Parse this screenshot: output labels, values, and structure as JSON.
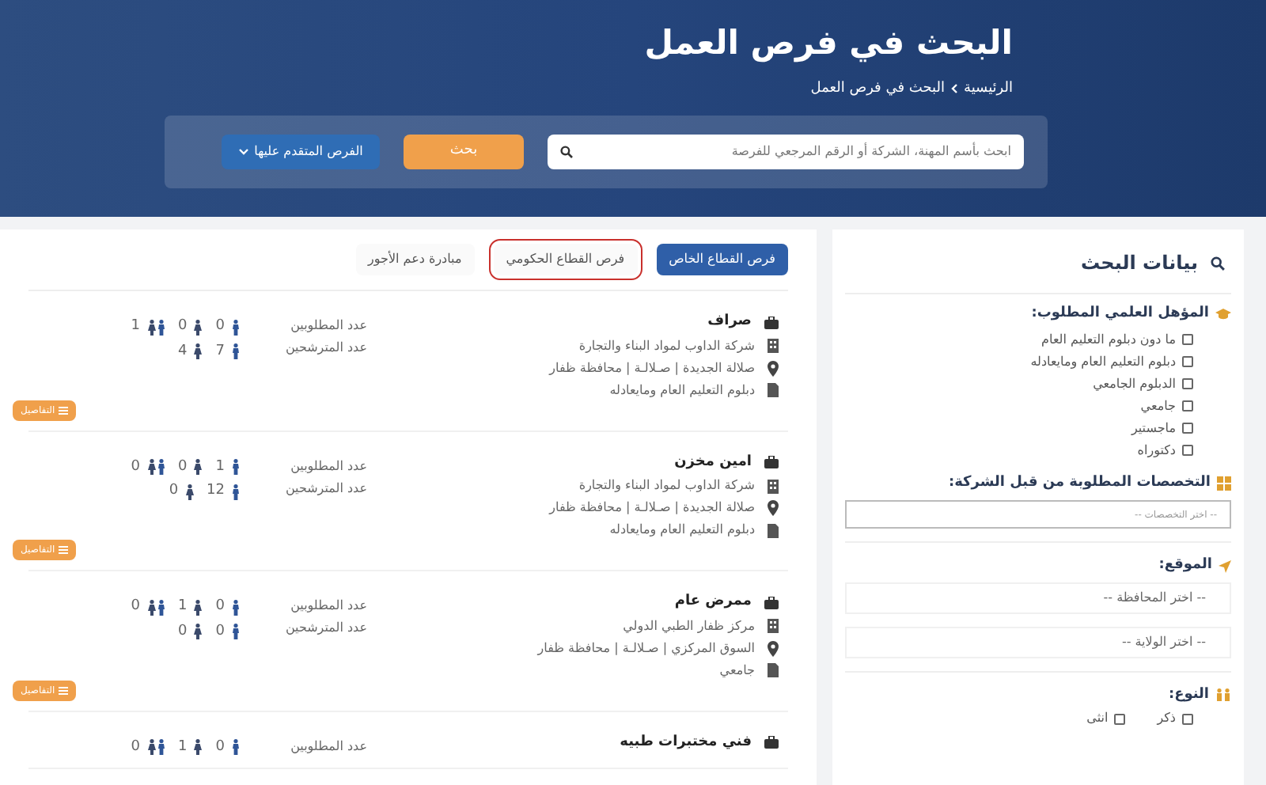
{
  "header": {
    "title": "البحث في فرص العمل",
    "breadcrumb": [
      "الرئيسية",
      "البحث في فرص العمل"
    ],
    "search": {
      "placeholder": "ابحث بأسم المهنة، الشركة أو الرقم المرجعي للفرصة"
    },
    "search_button": "بحث",
    "applied_button": "الفرص المتقدم عليها"
  },
  "tabs": [
    {
      "label": "فرص القطاع الخاص",
      "selected": true,
      "outlined": false
    },
    {
      "label": "فرص القطاع الحكومي",
      "selected": false,
      "outlined": true
    },
    {
      "label": "مبادرة دعم الأجور",
      "selected": false,
      "outlined": false
    }
  ],
  "jobs": [
    {
      "title": "صراف",
      "company": "شركة الداوب لمواد البناء والتجارة",
      "location": "صلالة الجديدة | صـلالـة | محافظة ظفار",
      "qualification": "دبلوم التعليم العام ومايعادله",
      "required_label": "عدد المطلوبين",
      "required": {
        "male": "0",
        "female": "0",
        "any": "1"
      },
      "registered_label": "عدد المترشحين",
      "registered": {
        "male": "7",
        "female": "4"
      },
      "details_button": "التفاصيل"
    },
    {
      "title": "امين مخزن",
      "company": "شركة الداوب لمواد البناء والتجارة",
      "location": "صلالة الجديدة | صـلالـة | محافظة ظفار",
      "qualification": "دبلوم التعليم العام ومايعادله",
      "required_label": "عدد المطلوبين",
      "required": {
        "male": "1",
        "female": "0",
        "any": "0"
      },
      "registered_label": "عدد المترشحين",
      "registered": {
        "male": "12",
        "female": "0"
      },
      "details_button": "التفاصيل"
    },
    {
      "title": "ممرض عام",
      "company": "مركز ظفار الطبي الدولي",
      "location": "السوق المركزي | صـلالـة | محافظة ظفار",
      "qualification": "جامعي",
      "required_label": "عدد المطلوبين",
      "required": {
        "male": "0",
        "female": "1",
        "any": "0"
      },
      "registered_label": "عدد المترشحين",
      "registered": {
        "male": "0",
        "female": "0"
      },
      "details_button": "التفاصيل"
    },
    {
      "title": "فني مختبرات طبيه",
      "required_label": "عدد المطلوبين",
      "required": {
        "male": "0",
        "female": "1",
        "any": "0"
      }
    }
  ],
  "sidebar": {
    "title": "بيانات البحث",
    "qualification": {
      "label": "المؤهل العلمي المطلوب:",
      "options": [
        {
          "label": "ما دون دبلوم التعليم العام",
          "checked": false
        },
        {
          "label": "دبلوم التعليم العام ومايعادله",
          "checked": false
        },
        {
          "label": "الدبلوم الجامعي",
          "checked": false
        },
        {
          "label": "جامعي",
          "checked": false
        },
        {
          "label": "ماجستير",
          "checked": false
        },
        {
          "label": "دكتوراه",
          "checked": false
        }
      ]
    },
    "specializations": {
      "label": "التخصصات المطلوبة من قبل الشركة:",
      "placeholder": "-- اختر التخصصات --"
    },
    "location": {
      "label": "الموقع:",
      "governorate": "-- اختر المحافظة --",
      "state": "-- اختر الولاية --"
    },
    "gender": {
      "label": "النوع:",
      "options": [
        {
          "label": "ذكر",
          "checked": false
        },
        {
          "label": "انثى",
          "checked": false
        }
      ]
    }
  }
}
